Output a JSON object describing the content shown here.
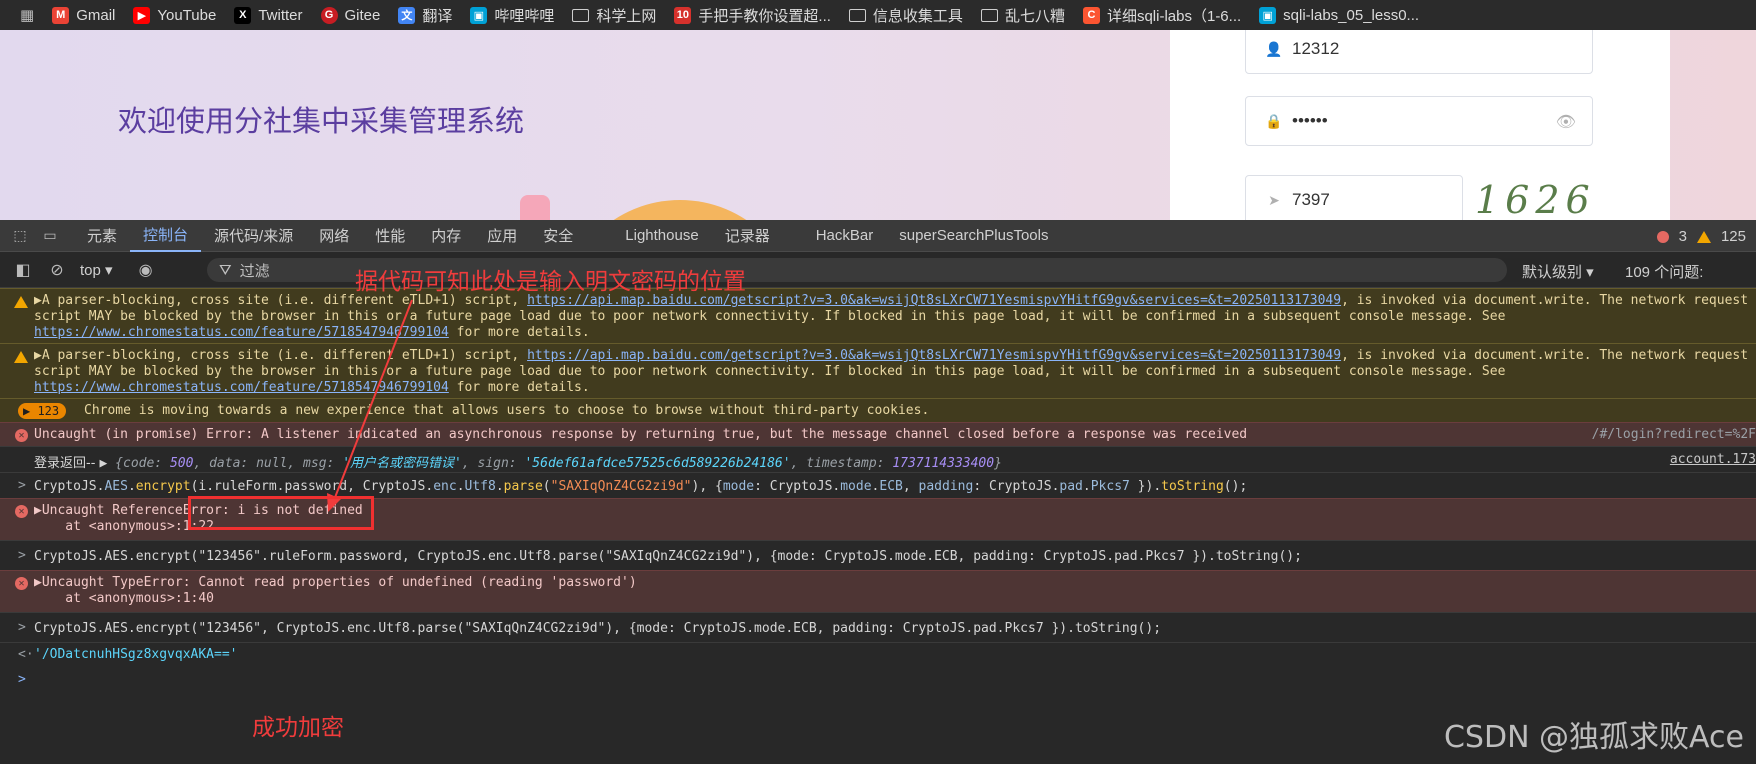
{
  "bookmarks": [
    {
      "label": "Gmail",
      "icon": "gmail-icon",
      "color": "#ea4335"
    },
    {
      "label": "YouTube",
      "icon": "youtube-icon",
      "color": "#ff0000"
    },
    {
      "label": "Twitter",
      "icon": "x-icon",
      "color": "#000000"
    },
    {
      "label": "Gitee",
      "icon": "gitee-icon",
      "color": "#c71d23"
    },
    {
      "label": "翻译",
      "icon": "translate-icon",
      "color": "#4285f4"
    },
    {
      "label": "哔哩哔哩",
      "icon": "bilibili-icon",
      "color": "#00a1d6"
    },
    {
      "label": "科学上网",
      "icon": "folder-icon"
    },
    {
      "label": "手把手教你设置超...",
      "icon": "page-icon",
      "color": "#d6312c"
    },
    {
      "label": "信息收集工具",
      "icon": "folder-icon"
    },
    {
      "label": "乱七八糟",
      "icon": "folder-icon"
    },
    {
      "label": "详细sqli-labs（1-6...",
      "icon": "csdn-icon",
      "color": "#fc5531"
    },
    {
      "label": "sqli-labs_05_less0...",
      "icon": "bilibili-icon",
      "color": "#00a1d6"
    }
  ],
  "webpage": {
    "welcome": "欢迎使用分社集中采集管理系统",
    "username": "12312",
    "password_masked": "••••••",
    "captcha_input": "7397",
    "captcha_image": "1626"
  },
  "devtools": {
    "tabs": [
      "元素",
      "控制台",
      "源代码/来源",
      "网络",
      "性能",
      "内存",
      "应用",
      "安全",
      "Lighthouse",
      "记录器",
      "HackBar",
      "superSearchPlusTools"
    ],
    "active_tab": "控制台",
    "error_count": "3",
    "warning_count": "125",
    "context": "top",
    "filter_placeholder": "过滤",
    "level": "默认级别",
    "issues": "109 个问题:"
  },
  "console": {
    "warn1": {
      "l1a": "▶A parser-blocking, cross site (i.e. different eTLD+1) script, ",
      "l1link": "https://api.map.baidu.com/getscript?v=3.0&ak=wsijQt8sLXrCW71YesmispvYHitfG9gv&services=&t=20250113173049",
      "l1b": ", is invoked via document.write. The network request for this",
      "l2": "script MAY be blocked by the browser in this or a future page load due to poor network connectivity. If blocked in this page load, it will be confirmed in a subsequent console message. See",
      "l3link": "https://www.chromestatus.com/feature/5718547946799104",
      "l3b": " for more details."
    },
    "badge": "123",
    "info_msg": "Chrome is moving towards a new experience that allows users to choose to browse without third-party cookies.",
    "error1": "Uncaught (in promise) Error: A listener indicated an asynchronous response by returning true, but the message channel closed before a response was received",
    "error1_src": "/#/login?redirect=%2F",
    "login_prefix": "登录返回-- ",
    "login_obj": {
      "code": "500",
      "data": "null",
      "msg": "'用户名或密码错误'",
      "sign": "'56def61afdce57525c6d589226b24186'",
      "timestamp": "1737114333400"
    },
    "login_src": "account.173",
    "cmd1": {
      "a": "CryptoJS.",
      "b": "AES",
      "c": ".",
      "d": "encrypt",
      "e": "(i.ruleForm.password, CryptoJS.",
      "f": "enc",
      "g": ".",
      "h": "Utf8",
      "i": ".",
      "j": "parse",
      "k": "(",
      "l": "\"SAXIqQnZ4CG2zi9d\"",
      "m": "), {",
      "n": "mode",
      "o": ": CryptoJS.",
      "p": "mode",
      "q": ".",
      "r": "ECB",
      "s": ", ",
      "t": "padding",
      "u": ": CryptoJS.",
      "v": "pad",
      "w": ".",
      "x": "Pkcs7",
      "y": " }).",
      "z": "toString",
      "zz": "();"
    },
    "err2_l1": "▶Uncaught ReferenceError: i is not defined",
    "err2_l2": "    at <anonymous>:1:22",
    "cmd2_plain": "CryptoJS.AES.encrypt(\"123456\".ruleForm.password, CryptoJS.enc.Utf8.parse(\"SAXIqQnZ4CG2zi9d\"), {mode: CryptoJS.mode.ECB, padding: CryptoJS.pad.Pkcs7 }).toString();",
    "err3_l1": "▶Uncaught TypeError: Cannot read properties of undefined (reading 'password')",
    "err3_l2": "    at <anonymous>:1:40",
    "cmd3_plain": "CryptoJS.AES.encrypt(\"123456\", CryptoJS.enc.Utf8.parse(\"SAXIqQnZ4CG2zi9d\"), {mode: CryptoJS.mode.ECB, padding: CryptoJS.pad.Pkcs7 }).toString();",
    "result": "'/ODatcnuhHSgz8xgvqxAKA=='"
  },
  "annotations": {
    "top": "据代码可知此处是输入明文密码的位置",
    "bottom": "成功加密",
    "color": "#f03c3c"
  },
  "watermark": "CSDN @独孤求败Ace"
}
